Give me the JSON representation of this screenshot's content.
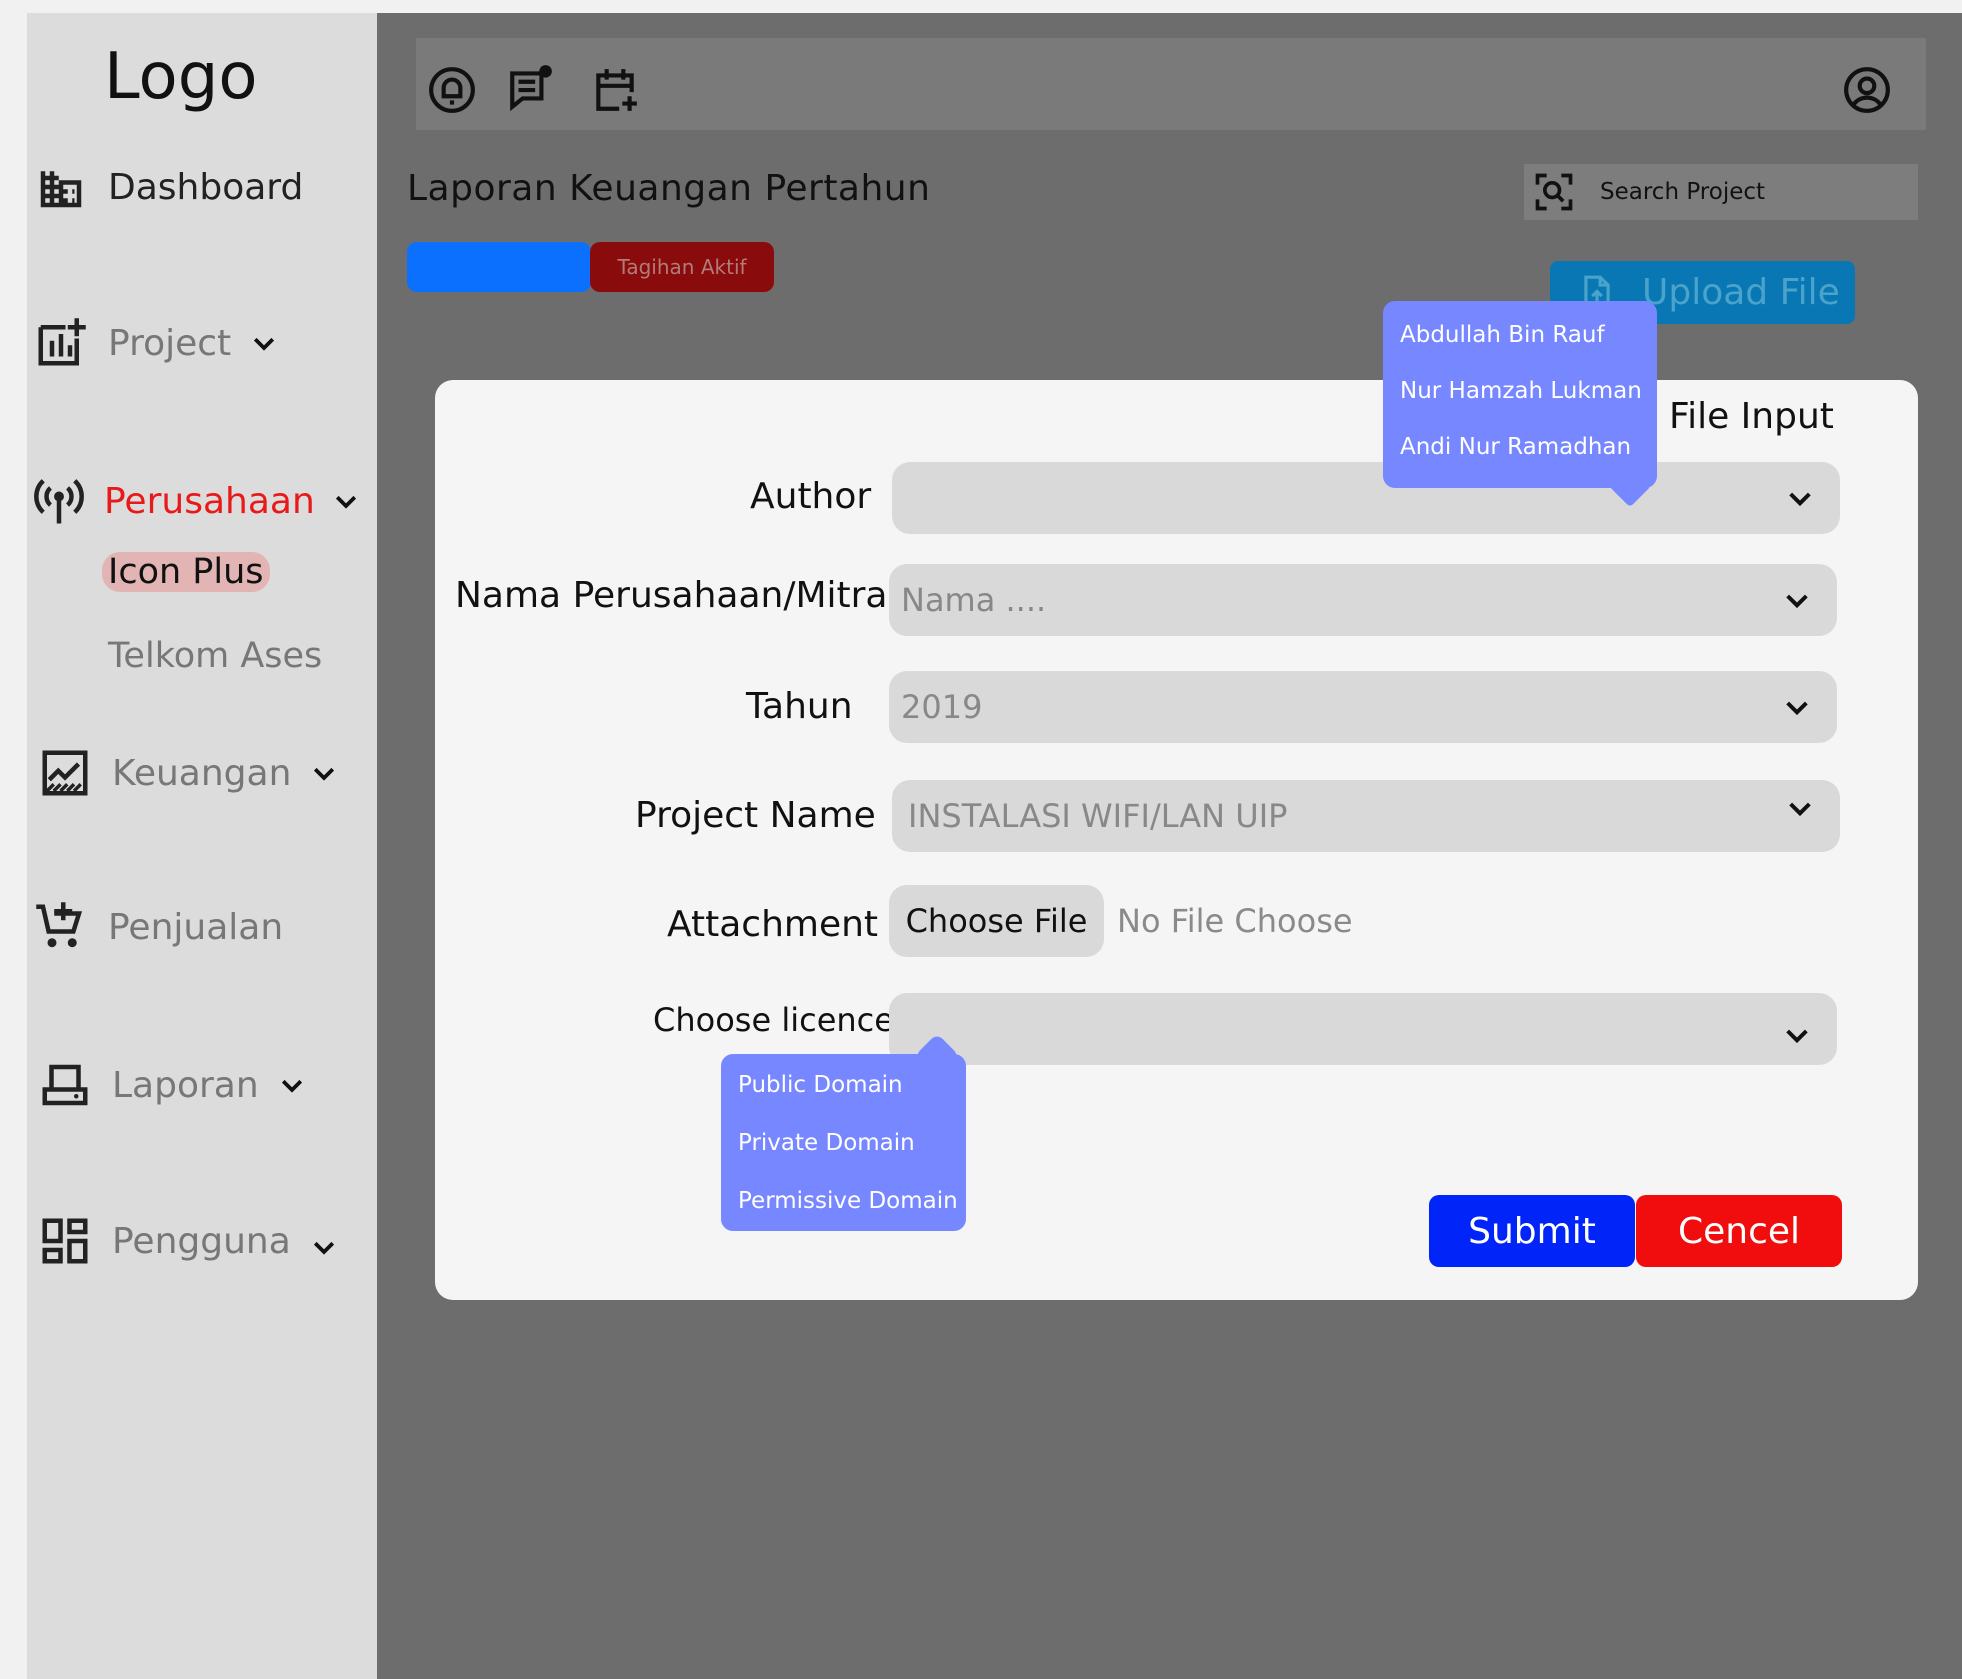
{
  "sidebar": {
    "logo": "Logo",
    "items": [
      {
        "label": "Dashboard",
        "icon": "building-icon"
      },
      {
        "label": "Project",
        "icon": "chart-plus-icon"
      },
      {
        "label": "Perusahaan",
        "icon": "antenna-icon"
      },
      {
        "label": "Keuangan",
        "icon": "trend-chart-icon"
      },
      {
        "label": "Penjualan",
        "icon": "cart-plus-icon"
      },
      {
        "label": "Laporan",
        "icon": "laptop-icon"
      },
      {
        "label": "Pengguna",
        "icon": "dashboard-grid-icon"
      }
    ],
    "sub_items": [
      "Icon Plus",
      "Telkom Ases"
    ]
  },
  "topbar": {
    "icons": [
      "bell-icon",
      "chat-icon",
      "calendar-add-icon",
      "user-icon"
    ]
  },
  "page": {
    "title": "Laporan Keuangan Pertahun",
    "search_placeholder": "Search Project",
    "tab_active_label": "Tagihan Aktif",
    "upload_label": "Upload File"
  },
  "modal": {
    "title": "File Input",
    "fields": {
      "author": {
        "label": "Author",
        "value": ""
      },
      "company": {
        "label": "Nama Perusahaan/Mitra",
        "value": "Nama ...."
      },
      "year": {
        "label": "Tahun",
        "value": "2019"
      },
      "project": {
        "label": "Project Name",
        "value": "INSTALASI WIFI/LAN UIP"
      },
      "attachment": {
        "label": "Attachment",
        "button": "Choose File",
        "status": "No File Choose"
      },
      "licence": {
        "label": "Choose licence",
        "value": ""
      }
    },
    "author_options": [
      "Abdullah Bin Rauf",
      "Nur Hamzah Lukman",
      "Andi Nur Ramadhan"
    ],
    "licence_options": [
      "Public Domain",
      "Private Domain",
      "Permissive Domain"
    ],
    "submit_label": "Submit",
    "cancel_label": "Cencel"
  },
  "colors": {
    "active_nav": "#e81919",
    "submit": "#0124f9",
    "cancel": "#f10d0d",
    "dropdown": "#7787ff",
    "upload": "#0877b4"
  }
}
